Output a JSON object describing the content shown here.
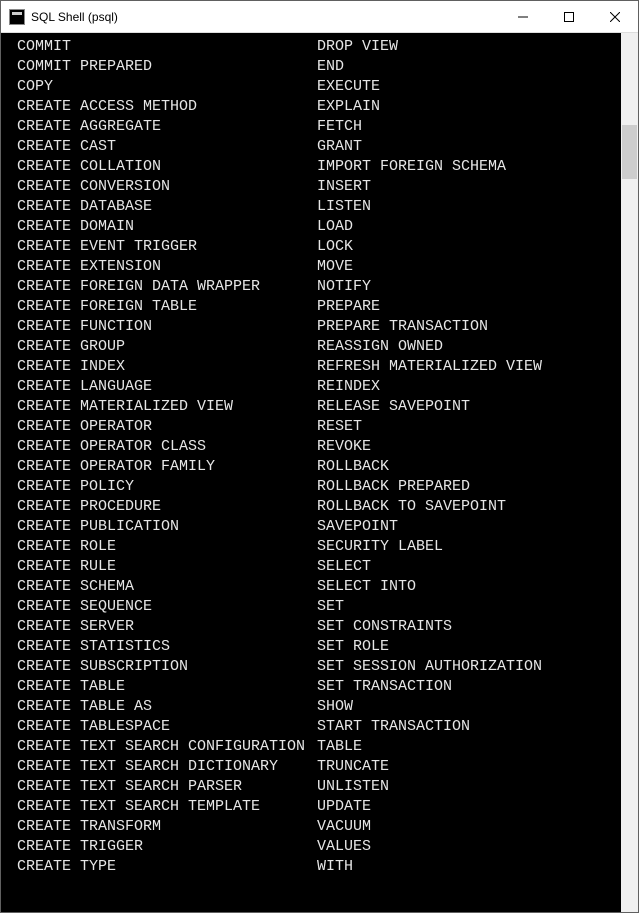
{
  "window": {
    "title": "SQL Shell (psql)"
  },
  "rows": [
    {
      "c1": "COMMIT",
      "c2": "DROP VIEW"
    },
    {
      "c1": "COMMIT PREPARED",
      "c2": "END"
    },
    {
      "c1": "COPY",
      "c2": "EXECUTE"
    },
    {
      "c1": "CREATE ACCESS METHOD",
      "c2": "EXPLAIN"
    },
    {
      "c1": "CREATE AGGREGATE",
      "c2": "FETCH"
    },
    {
      "c1": "CREATE CAST",
      "c2": "GRANT"
    },
    {
      "c1": "CREATE COLLATION",
      "c2": "IMPORT FOREIGN SCHEMA"
    },
    {
      "c1": "CREATE CONVERSION",
      "c2": "INSERT"
    },
    {
      "c1": "CREATE DATABASE",
      "c2": "LISTEN"
    },
    {
      "c1": "CREATE DOMAIN",
      "c2": "LOAD"
    },
    {
      "c1": "CREATE EVENT TRIGGER",
      "c2": "LOCK"
    },
    {
      "c1": "CREATE EXTENSION",
      "c2": "MOVE"
    },
    {
      "c1": "CREATE FOREIGN DATA WRAPPER",
      "c2": "NOTIFY"
    },
    {
      "c1": "CREATE FOREIGN TABLE",
      "c2": "PREPARE"
    },
    {
      "c1": "CREATE FUNCTION",
      "c2": "PREPARE TRANSACTION"
    },
    {
      "c1": "CREATE GROUP",
      "c2": "REASSIGN OWNED"
    },
    {
      "c1": "CREATE INDEX",
      "c2": "REFRESH MATERIALIZED VIEW"
    },
    {
      "c1": "CREATE LANGUAGE",
      "c2": "REINDEX"
    },
    {
      "c1": "CREATE MATERIALIZED VIEW",
      "c2": "RELEASE SAVEPOINT"
    },
    {
      "c1": "CREATE OPERATOR",
      "c2": "RESET"
    },
    {
      "c1": "CREATE OPERATOR CLASS",
      "c2": "REVOKE"
    },
    {
      "c1": "CREATE OPERATOR FAMILY",
      "c2": "ROLLBACK"
    },
    {
      "c1": "CREATE POLICY",
      "c2": "ROLLBACK PREPARED"
    },
    {
      "c1": "CREATE PROCEDURE",
      "c2": "ROLLBACK TO SAVEPOINT"
    },
    {
      "c1": "CREATE PUBLICATION",
      "c2": "SAVEPOINT"
    },
    {
      "c1": "CREATE ROLE",
      "c2": "SECURITY LABEL"
    },
    {
      "c1": "CREATE RULE",
      "c2": "SELECT"
    },
    {
      "c1": "CREATE SCHEMA",
      "c2": "SELECT INTO"
    },
    {
      "c1": "CREATE SEQUENCE",
      "c2": "SET"
    },
    {
      "c1": "CREATE SERVER",
      "c2": "SET CONSTRAINTS"
    },
    {
      "c1": "CREATE STATISTICS",
      "c2": "SET ROLE"
    },
    {
      "c1": "CREATE SUBSCRIPTION",
      "c2": "SET SESSION AUTHORIZATION"
    },
    {
      "c1": "CREATE TABLE",
      "c2": "SET TRANSACTION"
    },
    {
      "c1": "CREATE TABLE AS",
      "c2": "SHOW"
    },
    {
      "c1": "CREATE TABLESPACE",
      "c2": "START TRANSACTION"
    },
    {
      "c1": "CREATE TEXT SEARCH CONFIGURATION",
      "c2": "TABLE"
    },
    {
      "c1": "CREATE TEXT SEARCH DICTIONARY",
      "c2": "TRUNCATE"
    },
    {
      "c1": "CREATE TEXT SEARCH PARSER",
      "c2": "UNLISTEN"
    },
    {
      "c1": "CREATE TEXT SEARCH TEMPLATE",
      "c2": "UPDATE"
    },
    {
      "c1": "CREATE TRANSFORM",
      "c2": "VACUUM"
    },
    {
      "c1": "CREATE TRIGGER",
      "c2": "VALUES"
    },
    {
      "c1": "CREATE TYPE",
      "c2": "WITH"
    }
  ]
}
